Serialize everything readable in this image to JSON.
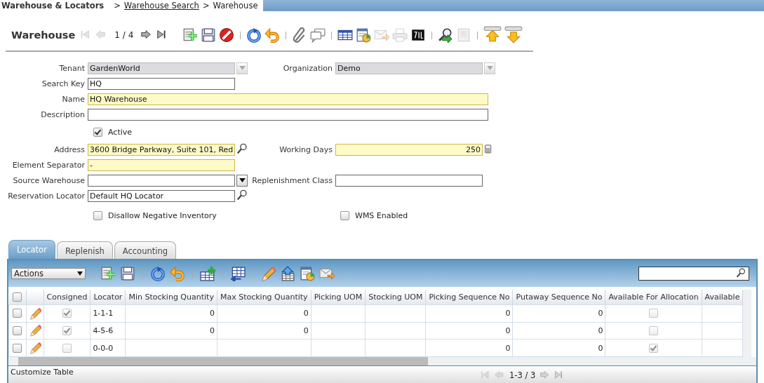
{
  "breadcrumb": {
    "window": "Warehouse & Locators",
    "separator": ">",
    "links": [
      {
        "label": "Warehouse Search",
        "link": true
      },
      {
        "label": "Warehouse",
        "link": false
      }
    ]
  },
  "header": {
    "title": "Warehouse",
    "nav_back": [
      {
        "kind": "first",
        "disabled": true
      },
      {
        "kind": "prev",
        "disabled": true
      }
    ],
    "position": "1 / 4",
    "nav_forward": [
      {
        "kind": "next",
        "disabled": false
      },
      {
        "kind": "last",
        "disabled": false
      }
    ],
    "toolbar": [
      [
        {
          "kind": "new",
          "disabled": false
        },
        {
          "kind": "save",
          "disabled": false
        },
        {
          "kind": "delete",
          "disabled": false
        }
      ],
      [
        {
          "kind": "refresh",
          "disabled": false
        },
        {
          "kind": "undo",
          "disabled": false
        }
      ],
      [
        {
          "kind": "attach",
          "disabled": false
        },
        {
          "kind": "chat",
          "disabled": false
        }
      ],
      [
        {
          "kind": "grid",
          "disabled": false
        },
        {
          "kind": "report",
          "disabled": false
        },
        {
          "kind": "mail",
          "disabled": true
        },
        {
          "kind": "print",
          "disabled": true
        },
        {
          "kind": "zip",
          "disabled": false
        }
      ],
      [
        {
          "kind": "zoom",
          "disabled": false
        },
        {
          "kind": "doc",
          "disabled": true
        }
      ],
      [
        {
          "kind": "up",
          "disabled": false
        },
        {
          "kind": "down",
          "disabled": false
        }
      ]
    ]
  },
  "form_rows": [
    {
      "left": {
        "label": "Tenant",
        "kind": "select",
        "value": "GardenWorld",
        "readonly": true,
        "mandatory": false
      },
      "right": {
        "label": "Organization",
        "kind": "select",
        "value": "Demo",
        "readonly": true,
        "mandatory": false
      }
    },
    {
      "left": {
        "label": "Search Key",
        "kind": "text",
        "value": "HQ",
        "readonly": false,
        "mandatory": false
      }
    },
    {
      "left": {
        "label": "Name",
        "kind": "wide_text",
        "value": "HQ Warehouse",
        "readonly": false,
        "mandatory": true
      }
    },
    {
      "left": {
        "label": "Description",
        "kind": "wide_text",
        "readonly": false,
        "mandatory": false
      }
    },
    {
      "left": {
        "label": "Active",
        "kind": "checkbox",
        "checked": true
      }
    },
    {
      "left": {
        "label": "Address",
        "kind": "search",
        "value": "3600 Bridge Parkway, Suite 101, Red",
        "readonly": false,
        "mandatory": true
      },
      "right": {
        "label": "Working Days",
        "kind": "number",
        "value": "250",
        "readonly": false,
        "mandatory": true
      }
    },
    {
      "left": {
        "label": "Element Separator",
        "kind": "text",
        "value": "-",
        "readonly": false,
        "mandatory": true
      }
    },
    {
      "left": {
        "label": "Source Warehouse",
        "kind": "select",
        "readonly": false,
        "mandatory": false
      },
      "right": {
        "label": "Replenishment Class",
        "kind": "text",
        "readonly": false,
        "mandatory": false
      }
    },
    {
      "left": {
        "label": "Reservation Locator",
        "kind": "search",
        "value": "Default HQ Locator",
        "readonly": false,
        "mandatory": false
      }
    },
    {
      "left": {
        "label": "Disallow Negative Inventory",
        "kind": "checkbox",
        "checked": false
      },
      "right": {
        "label": "WMS Enabled",
        "kind": "checkbox",
        "checked": false
      }
    }
  ],
  "tabs": [
    {
      "label": "Locator",
      "selected": true
    },
    {
      "label": "Replenish",
      "selected": false
    },
    {
      "label": "Accounting",
      "selected": false
    }
  ],
  "detail_toolbar": {
    "actions": "Actions",
    "groups": [
      [
        {
          "kind": "new",
          "disabled": false
        },
        {
          "kind": "save",
          "disabled": false
        }
      ],
      [
        {
          "kind": "refresh",
          "disabled": false
        },
        {
          "kind": "undo",
          "disabled": false
        }
      ],
      [
        {
          "kind": "addgrid",
          "disabled": false
        }
      ],
      [
        {
          "kind": "gridarrow",
          "disabled": false
        }
      ],
      [
        {
          "kind": "pencil",
          "disabled": false
        },
        {
          "kind": "uptable",
          "disabled": false
        },
        {
          "kind": "report",
          "disabled": false
        },
        {
          "kind": "mail",
          "disabled": false
        }
      ]
    ]
  },
  "table": {
    "select_all": false,
    "columns": [
      {
        "label": "Consigned",
        "kind": "check"
      },
      {
        "label": "Locator",
        "kind": "text"
      },
      {
        "label": "Min Stocking Quantity",
        "kind": "number"
      },
      {
        "label": "Max Stocking Quantity",
        "kind": "number"
      },
      {
        "label": "Picking UOM",
        "kind": "text"
      },
      {
        "label": "Stocking UOM",
        "kind": "text"
      },
      {
        "label": "Picking Sequence No",
        "kind": "number"
      },
      {
        "label": "Putaway Sequence No",
        "kind": "number"
      },
      {
        "label": "Available For Allocation",
        "kind": "check"
      },
      {
        "label": "Available",
        "kind": "text"
      }
    ],
    "rows": [
      {
        "selected": false,
        "cells": [
          true,
          "1-1-1",
          "0",
          "0",
          null,
          null,
          "0",
          "0",
          false,
          null
        ]
      },
      {
        "selected": false,
        "cells": [
          true,
          "4-5-6",
          "0",
          "0",
          null,
          null,
          "0",
          "0",
          false,
          null
        ]
      },
      {
        "selected": false,
        "cells": [
          false,
          "0-0-0",
          null,
          null,
          null,
          null,
          "0",
          "0",
          true,
          null
        ]
      }
    ]
  },
  "footer": {
    "customize": "Customize Table",
    "pager": "1-3 / 3"
  }
}
